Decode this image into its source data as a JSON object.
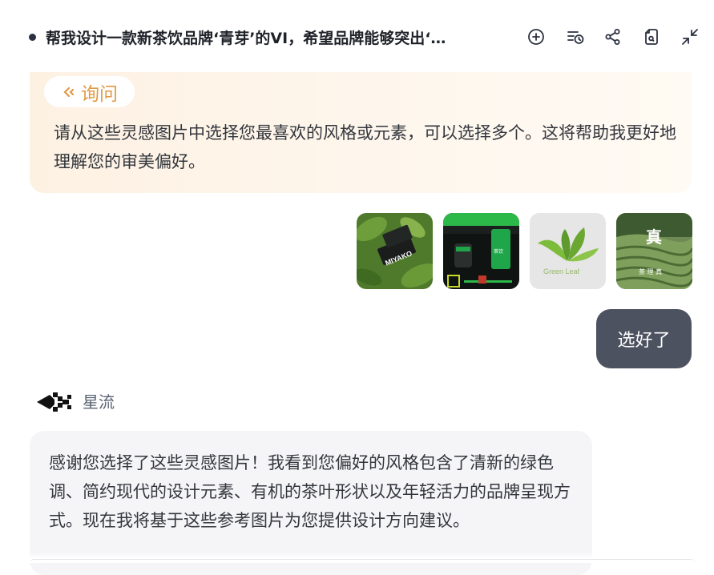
{
  "header": {
    "title": "帮我设计一款新茶饮品牌‘青芽’的VI，希望品牌能够突出‘…",
    "icons": [
      "new-chat-icon",
      "history-icon",
      "share-icon",
      "document-icon",
      "collapse-icon"
    ]
  },
  "ask": {
    "badge_label": "询问",
    "message": "请从这些灵感图片中选择您最喜欢的风格或元素，可以选择多个。这将帮助我更好地理解您的审美偏好。"
  },
  "inspiration_images": [
    {
      "label": "MIYAKO",
      "theme": "green-leaf-business-cards"
    },
    {
      "label": "",
      "theme": "green-black-packaging"
    },
    {
      "label": "Green Leaf",
      "theme": "leaf-logo-on-paper"
    },
    {
      "label": "",
      "theme": "tea-field-logo"
    }
  ],
  "user_message": "选好了",
  "assistant": {
    "name": "星流",
    "message": "感谢您选择了这些灵感图片！我看到您偏好的风格包含了清新的绿色调、简约现代的设计元素、有机的茶叶形状以及年轻活力的品牌呈现方式。现在我将基于这些参考图片为您提供设计方向建议。"
  },
  "colors": {
    "accent_orange": "#e09a45",
    "ask_bg": "#fdf3e6",
    "user_bubble": "#4d5260",
    "assistant_bg": "#f5f5f7"
  }
}
